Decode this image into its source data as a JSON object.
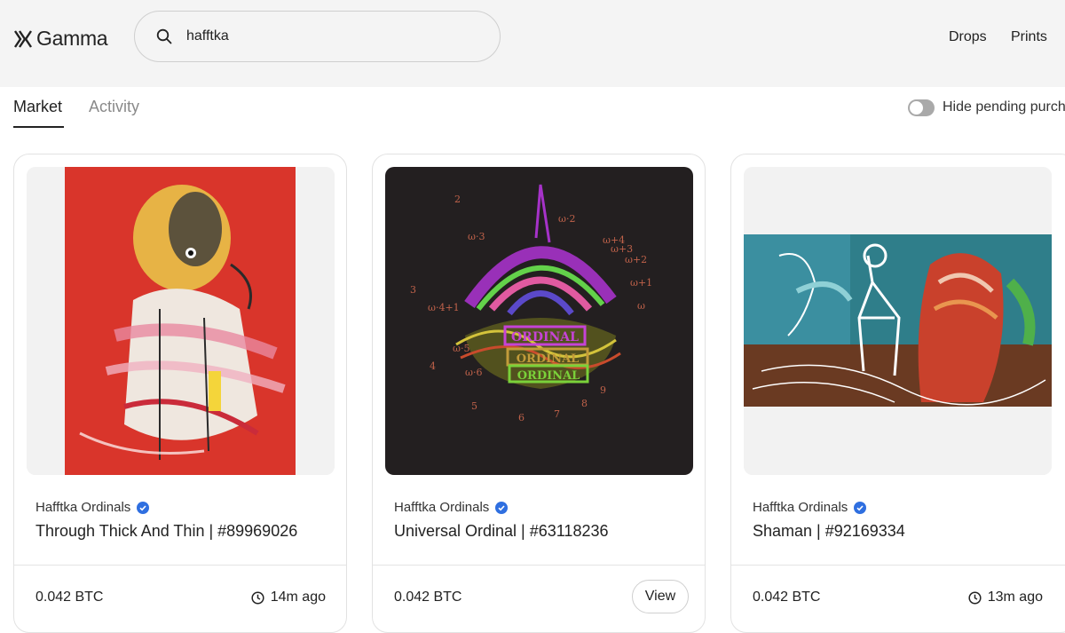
{
  "header": {
    "brand": "Gamma",
    "search": {
      "value": "hafftka",
      "placeholder": ""
    },
    "nav": [
      "Drops",
      "Prints"
    ]
  },
  "tabs": [
    {
      "label": "Market",
      "active": true
    },
    {
      "label": "Activity",
      "active": false
    }
  ],
  "filters": {
    "hide_pending_label": "Hide pending purch",
    "hide_pending_on": false
  },
  "cards": [
    {
      "collection": "Hafftka Ordinals",
      "verified": true,
      "title": "Through Thick And Thin | #89969026",
      "price": "0.042 BTC",
      "time": "14m ago",
      "image": "red-abstract-portrait"
    },
    {
      "collection": "Hafftka Ordinals",
      "verified": true,
      "title": "Universal Ordinal | #63118236",
      "price": "0.042 BTC",
      "action": "View",
      "image": "ordinal-sigil-artwork"
    },
    {
      "collection": "Hafftka Ordinals",
      "verified": true,
      "title": "Shaman | #92169334",
      "price": "0.042 BTC",
      "time": "13m ago",
      "image": "shaman-figures-artwork"
    }
  ],
  "artwork_labels": {
    "numbers": [
      "2",
      "3",
      "4",
      "5",
      "6",
      "7",
      "8",
      "9"
    ],
    "omegas": [
      "ω·2",
      "ω·3",
      "ω+4",
      "ω+3",
      "ω+2",
      "ω+1",
      "ω",
      "ω·4+1",
      "ω·5",
      "ω·6"
    ],
    "sign_text": [
      "ORDINAL",
      "ORDINAL",
      "ORDINAL"
    ]
  },
  "colors": {
    "accent_blue": "#2f6fe0",
    "header_bg": "#f4f4f4",
    "toggle_off": "#a9a9a9"
  }
}
